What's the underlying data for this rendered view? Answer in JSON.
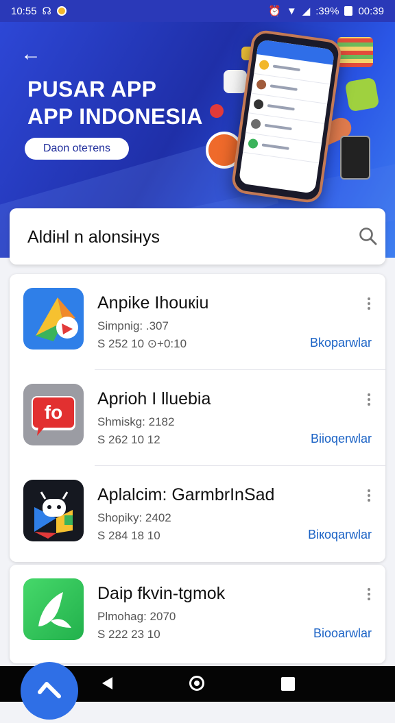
{
  "status_bar": {
    "time_left": "10:55",
    "time_right": "00:39",
    "battery": ":39%"
  },
  "hero": {
    "title_line1": "PUSAR APP",
    "title_line2": "APP INDONESIA",
    "button_label": "Daon oteтens"
  },
  "search": {
    "value": "Aldiнl n alonsiнys"
  },
  "apps": [
    {
      "title": "Anpike Ihouкiu",
      "sub1": "Simpnig: .307",
      "sub2": "S 252 10  ⊙+0:10",
      "action": "Bkoparwlar"
    },
    {
      "title": "Aprioh I lluebia",
      "sub1": "Shmiskg: 2182",
      "sub2": "S 262 10 12",
      "action": "Biioqerwlar"
    },
    {
      "title": "Aplalcim: GarmbrInSad",
      "sub1": "Shopiky: 2402",
      "sub2": "S 284 18 10",
      "action": "Biкoqarwlar"
    },
    {
      "title": "Daip fkvin-tgmok",
      "sub1": "Plmohag: 2070",
      "sub2": "S 222 23 10",
      "action": "Biooarwlar"
    }
  ],
  "icons": {
    "app1": "colorful-triangle-logo",
    "app2": "fo-speech-bubble",
    "app3": "robot-play-logo",
    "app4": "green-leaf-logo"
  },
  "colors": {
    "accent": "#2a39b8",
    "action_link": "#1a62c5"
  }
}
